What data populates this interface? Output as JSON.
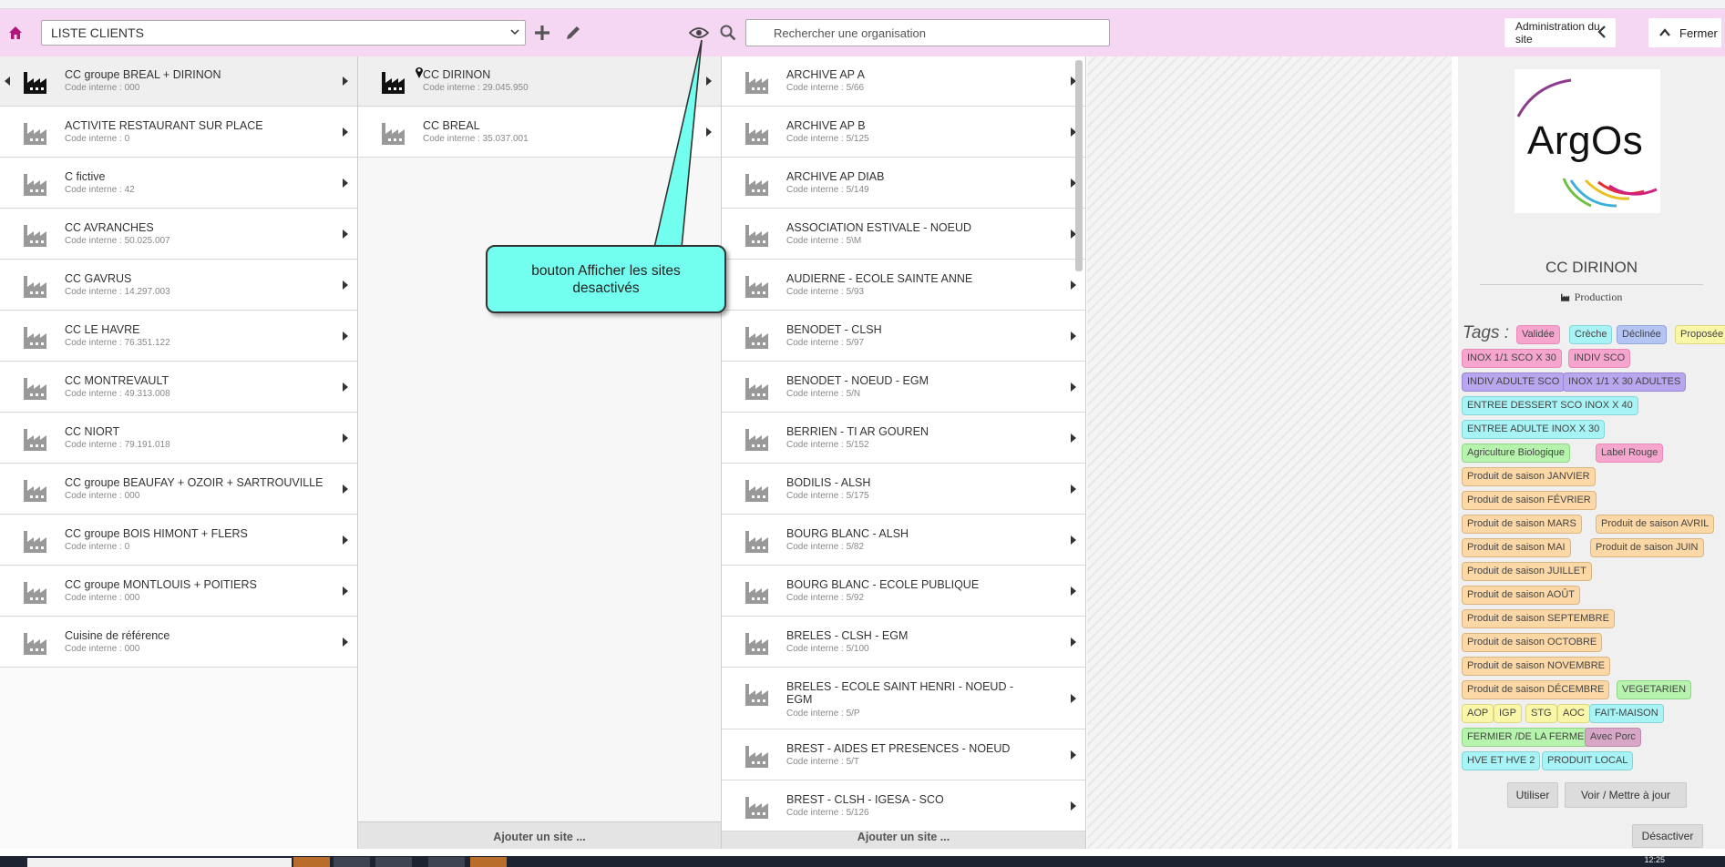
{
  "toolbar": {
    "list_select": "LISTE CLIENTS",
    "search_placeholder": "Rechercher une organisation",
    "admin_label": "Administration du site",
    "close_label": "Fermer"
  },
  "clients": [
    {
      "name": "CC groupe BREAL + DIRINON",
      "code": "Code interne : 000",
      "selected": true
    },
    {
      "name": "ACTIVITE RESTAURANT SUR PLACE",
      "code": "Code interne : 0"
    },
    {
      "name": "C fictive",
      "code": "Code interne : 42"
    },
    {
      "name": "CC AVRANCHES",
      "code": "Code interne : 50.025.007"
    },
    {
      "name": "CC GAVRUS",
      "code": "Code interne : 14.297.003"
    },
    {
      "name": "CC LE HAVRE",
      "code": "Code interne : 76.351.122"
    },
    {
      "name": "CC MONTREVAULT",
      "code": "Code interne : 49.313.008"
    },
    {
      "name": "CC NIORT",
      "code": "Code interne : 79.191.018"
    },
    {
      "name": "CC groupe BEAUFAY + OZOIR + SARTROUVILLE",
      "code": "Code interne : 000"
    },
    {
      "name": "CC groupe BOIS HIMONT + FLERS",
      "code": "Code interne : 0"
    },
    {
      "name": "CC groupe MONTLOUIS + POITIERS",
      "code": "Code interne : 000"
    },
    {
      "name": "Cuisine de référence",
      "code": "Code interne : 000"
    }
  ],
  "kitchens": [
    {
      "name": "CC DIRINON",
      "code": "Code interne : 29.045.950",
      "selected": true
    },
    {
      "name": "CC BREAL",
      "code": "Code interne : 35.037.001"
    }
  ],
  "sites": [
    {
      "name": "ARCHIVE AP A",
      "code": "Code interne : 5/66"
    },
    {
      "name": "ARCHIVE AP B",
      "code": "Code interne : 5/125"
    },
    {
      "name": "ARCHIVE AP DIAB",
      "code": "Code interne : 5/149"
    },
    {
      "name": "ASSOCIATION ESTIVALE - NOEUD",
      "code": "Code interne : 5\\M"
    },
    {
      "name": "AUDIERNE - ECOLE SAINTE ANNE",
      "code": "Code interne : 5/93"
    },
    {
      "name": "BENODET - CLSH",
      "code": "Code interne : 5/97"
    },
    {
      "name": "BENODET - NOEUD - EGM",
      "code": "Code interne : 5/N"
    },
    {
      "name": "BERRIEN - TI AR GOUREN",
      "code": "Code interne : 5/152"
    },
    {
      "name": "BODILIS - ALSH",
      "code": "Code interne : 5/175"
    },
    {
      "name": "BOURG BLANC - ALSH",
      "code": "Code interne : 5/82"
    },
    {
      "name": "BOURG BLANC - ECOLE PUBLIQUE",
      "code": "Code interne : 5/92"
    },
    {
      "name": "BRELES - CLSH - EGM",
      "code": "Code interne : 5/100"
    },
    {
      "name": "BRELES - ECOLE SAINT HENRI - NOEUD - EGM",
      "code": "Code interne : 5/P"
    },
    {
      "name": "BREST - AIDES ET PRESENCES - NOEUD",
      "code": "Code interne : 5/T"
    },
    {
      "name": "BREST - CLSH - IGESA - SCO",
      "code": "Code interne : 5/126"
    }
  ],
  "add_site_label": "Ajouter un site ...",
  "callout_text": "bouton Afficher les sites desactivés",
  "detail": {
    "logo_text": "ArgOs",
    "org_name": "CC DIRINON",
    "org_type": "Production",
    "tags_label": "Tags :",
    "tags": [
      {
        "label": "Validée",
        "color": "pink"
      },
      {
        "label": "Crèche",
        "color": "cyan"
      },
      {
        "label": "Déclinée",
        "color": "blue"
      },
      {
        "label": "Proposée",
        "color": "yellow"
      },
      {
        "label": "INOX 1/1 SCO X 30",
        "color": "pink"
      },
      {
        "label": "INDIV SCO",
        "color": "pink"
      },
      {
        "label": "INDIV ADULTE SCO",
        "color": "violet"
      },
      {
        "label": "INOX 1/1 X 30 ADULTES",
        "color": "violet"
      },
      {
        "label": "ENTREE DESSERT SCO INOX X 40",
        "color": "cyan"
      },
      {
        "label": "ENTREE ADULTE INOX X 30",
        "color": "cyan"
      },
      {
        "label": "Agriculture Biologique",
        "color": "green"
      },
      {
        "label": "Label Rouge",
        "color": "pink"
      },
      {
        "label": "Produit de saison JANVIER",
        "color": "orange"
      },
      {
        "label": "Produit de saison FÉVRIER",
        "color": "orange"
      },
      {
        "label": "Produit de saison MARS",
        "color": "orange"
      },
      {
        "label": "Produit de saison AVRIL",
        "color": "orange"
      },
      {
        "label": "Produit de saison MAI",
        "color": "orange"
      },
      {
        "label": "Produit de saison JUIN",
        "color": "orange"
      },
      {
        "label": "Produit de saison JUILLET",
        "color": "orange"
      },
      {
        "label": "Produit de saison AOÛT",
        "color": "orange"
      },
      {
        "label": "Produit de saison SEPTEMBRE",
        "color": "orange"
      },
      {
        "label": "Produit de saison OCTOBRE",
        "color": "orange"
      },
      {
        "label": "Produit de saison NOVEMBRE",
        "color": "orange"
      },
      {
        "label": "Produit de saison DÉCEMBRE",
        "color": "orange"
      },
      {
        "label": "VEGETARIEN",
        "color": "green"
      },
      {
        "label": "AOP",
        "color": "yellow"
      },
      {
        "label": "IGP",
        "color": "yellow"
      },
      {
        "label": "STG",
        "color": "yellow"
      },
      {
        "label": "AOC",
        "color": "yellow"
      },
      {
        "label": "FAIT-MAISON",
        "color": "cyan"
      },
      {
        "label": "FERMIER /DE LA FERME",
        "color": "green"
      },
      {
        "label": "Avec Porc",
        "color": "mauve"
      },
      {
        "label": "HVE ET HVE 2",
        "color": "cyan"
      },
      {
        "label": "PRODUIT LOCAL",
        "color": "cyan"
      }
    ],
    "use_label": "Utiliser",
    "view_label": "Voir / Mettre à jour",
    "deactivate_label": "Désactiver"
  },
  "taskbar_clock": "12:25",
  "colors": {
    "topbar": "#f5d7f3",
    "callout": "#73ffef"
  }
}
